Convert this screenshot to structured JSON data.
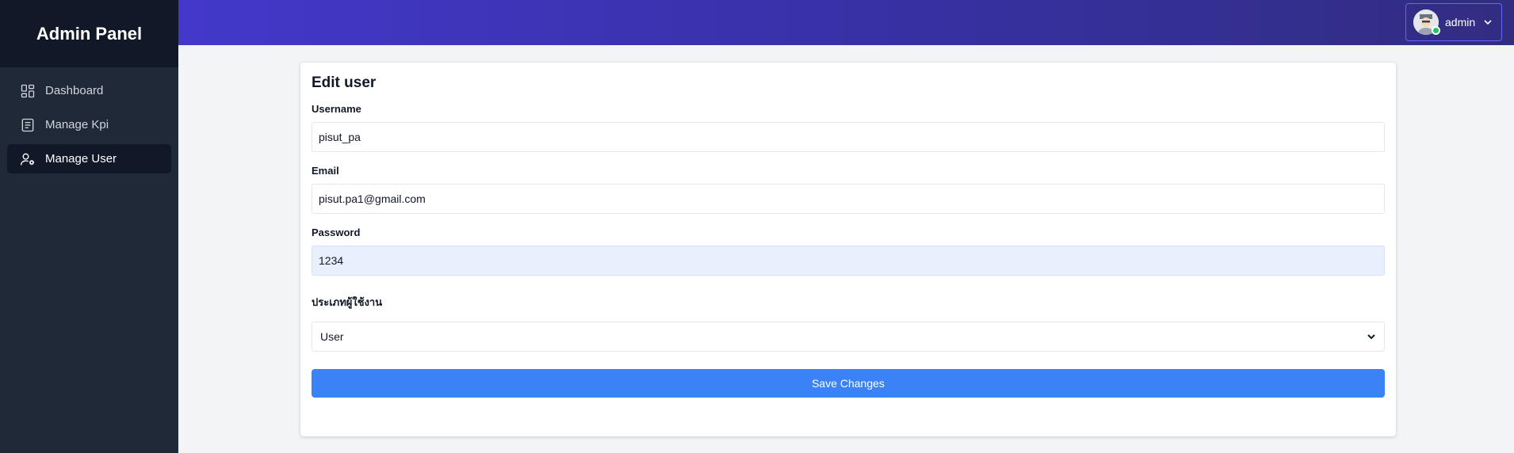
{
  "sidebar": {
    "brand": "Admin Panel",
    "items": [
      {
        "label": "Dashboard",
        "icon": "dashboard-icon",
        "active": false
      },
      {
        "label": "Manage Kpi",
        "icon": "list-icon",
        "active": false
      },
      {
        "label": "Manage User",
        "icon": "user-cog-icon",
        "active": true
      }
    ]
  },
  "topbar": {
    "user_name": "admin",
    "avatar_icon": "avatar-icon",
    "status_color": "#22c55e"
  },
  "form": {
    "title": "Edit user",
    "username_label": "Username",
    "username_value": "pisut_pa",
    "email_label": "Email",
    "email_value": "pisut.pa1@gmail.com",
    "password_label": "Password",
    "password_value": "1234",
    "user_type_label": "ประเภทผู้ใช้งาน",
    "user_type_selected": "User",
    "save_label": "Save Changes"
  },
  "colors": {
    "accent": "#3b82f6",
    "sidebar_bg": "#1f2937",
    "topbar_start": "#4338ca",
    "topbar_end": "#312e81"
  }
}
